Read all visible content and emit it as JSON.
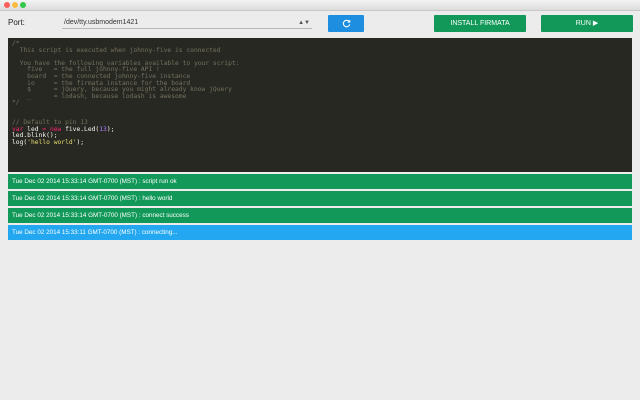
{
  "toolbar": {
    "port_label": "Port:",
    "port_value": "/dev/tty.usbmodem1421",
    "refresh_icon": "refresh-icon",
    "install_label": "INSTALL FIRMATA",
    "run_label": "RUN ▶"
  },
  "editor": {
    "lines": [
      {
        "parts": [
          {
            "t": "/*",
            "c": "c"
          }
        ]
      },
      {
        "parts": [
          {
            "t": "  This script is executed when johnny-five is connected",
            "c": "c"
          }
        ]
      },
      {
        "parts": [
          {
            "t": "",
            "c": "c"
          }
        ]
      },
      {
        "parts": [
          {
            "t": "  You have the following variables available to your script:",
            "c": "c"
          }
        ]
      },
      {
        "parts": [
          {
            "t": "    five   = the full johnny-five API !",
            "c": "c"
          }
        ]
      },
      {
        "parts": [
          {
            "t": "    board  = the connected johnny-five instance",
            "c": "c"
          }
        ]
      },
      {
        "parts": [
          {
            "t": "    io     = the firmata instance for the board",
            "c": "c"
          }
        ]
      },
      {
        "parts": [
          {
            "t": "    $      = jQuery, because you might already know jQuery",
            "c": "c"
          }
        ]
      },
      {
        "parts": [
          {
            "t": "    _      = lodash, because lodash is awesome",
            "c": "c"
          }
        ]
      },
      {
        "parts": [
          {
            "t": "*/",
            "c": "c"
          }
        ]
      },
      {
        "parts": [
          {
            "t": "",
            "c": ""
          }
        ]
      },
      {
        "parts": [
          {
            "t": "",
            "c": ""
          }
        ]
      },
      {
        "parts": [
          {
            "t": "// Default to pin 13",
            "c": "c"
          }
        ]
      },
      {
        "parts": [
          {
            "t": "var",
            "c": "k"
          },
          {
            "t": " led ",
            "c": ""
          },
          {
            "t": "=",
            "c": "k"
          },
          {
            "t": " ",
            "c": ""
          },
          {
            "t": "new",
            "c": "k"
          },
          {
            "t": " five.Led(",
            "c": ""
          },
          {
            "t": "13",
            "c": "n"
          },
          {
            "t": ");",
            "c": ""
          }
        ]
      },
      {
        "parts": [
          {
            "t": "led.blink();",
            "c": ""
          }
        ]
      },
      {
        "parts": [
          {
            "t": "log(",
            "c": ""
          },
          {
            "t": "'hello world'",
            "c": "s"
          },
          {
            "t": ");",
            "c": ""
          }
        ]
      }
    ]
  },
  "log": [
    {
      "text": "Tue Dec 02 2014 15:33:14 GMT-0700 (MST) : script run ok",
      "status": "ok"
    },
    {
      "text": "Tue Dec 02 2014 15:33:14 GMT-0700 (MST) : hello world",
      "status": "ok"
    },
    {
      "text": "Tue Dec 02 2014 15:33:14 GMT-0700 (MST) : connect success",
      "status": "ok"
    },
    {
      "text": "Tue Dec 02 2014 15:33:11 GMT-0700 (MST) : connecting...",
      "status": "info"
    }
  ]
}
